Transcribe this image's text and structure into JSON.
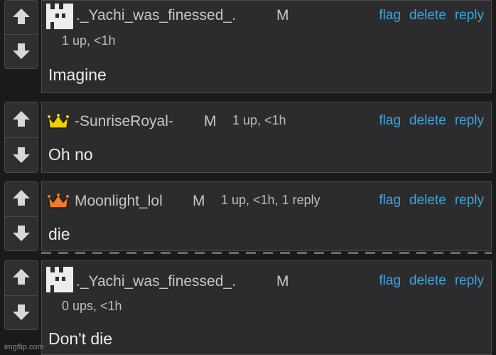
{
  "comments": [
    {
      "username": "._Yachi_was_finessed_.",
      "mod_tag": "M",
      "meta": "1 up, <1h",
      "body": "Imagine",
      "avatar": "pixel-castle-icon",
      "actions": {
        "flag": "flag",
        "delete": "delete",
        "reply": "reply"
      }
    },
    {
      "username": "-SunriseRoyal-",
      "mod_tag": "M",
      "meta": "1 up, <1h",
      "body": "Oh no",
      "avatar": "yellow-crown-icon",
      "actions": {
        "flag": "flag",
        "delete": "delete",
        "reply": "reply"
      }
    },
    {
      "username": "Moonlight_lol",
      "mod_tag": "M",
      "meta": "1 up, <1h, 1 reply",
      "body": "die",
      "avatar": "orange-crown-icon",
      "actions": {
        "flag": "flag",
        "delete": "delete",
        "reply": "reply"
      }
    },
    {
      "username": "._Yachi_was_finessed_.",
      "mod_tag": "M",
      "meta": "0 ups, <1h",
      "body": "Don't die",
      "avatar": "pixel-castle-icon",
      "actions": {
        "flag": "flag",
        "delete": "delete",
        "reply": "reply"
      }
    }
  ],
  "colors": {
    "link": "#3aa7e0",
    "yellow_crown": "#f0d000",
    "orange_crown": "#f07a2a"
  },
  "watermark": "imgflip.com"
}
